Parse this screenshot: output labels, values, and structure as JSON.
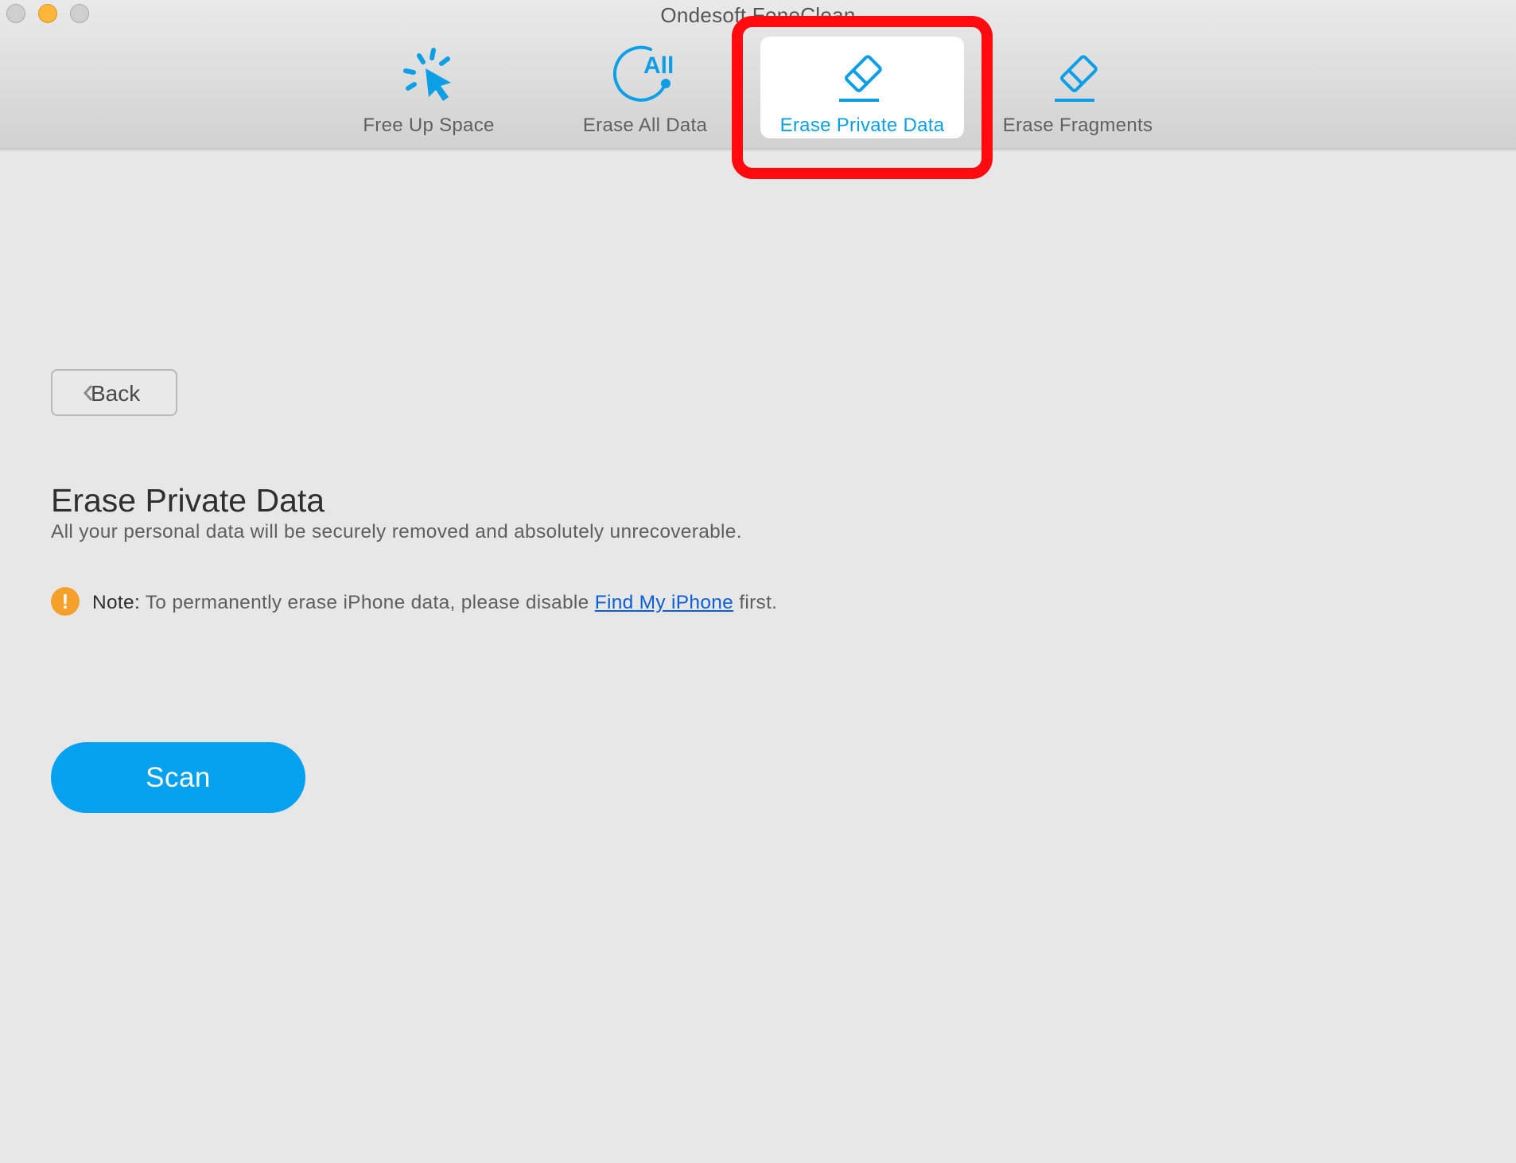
{
  "window": {
    "title": "Ondesoft FoneClean",
    "controls": [
      "close",
      "minimize",
      "maximize"
    ]
  },
  "toolbar": {
    "tabs": [
      {
        "label": "Free Up Space",
        "icon": "cursor-click-icon",
        "selected": false
      },
      {
        "label": "Erase All Data",
        "icon": "erase-all-icon",
        "selected": false
      },
      {
        "label": "Erase Private Data",
        "icon": "eraser-icon",
        "selected": true
      },
      {
        "label": "Erase Fragments",
        "icon": "eraser-icon",
        "selected": false
      }
    ]
  },
  "main": {
    "back_label": "Back",
    "heading": "Erase Private Data",
    "subtitle": "All your personal data will be securely removed and absolutely unrecoverable.",
    "note": {
      "icon": "warning-icon",
      "icon_glyph": "!",
      "lead": "Note:",
      "text_before": "To permanently erase iPhone data, please disable",
      "link": "Find My iPhone",
      "text_after": "first."
    },
    "scan_label": "Scan"
  },
  "colors": {
    "accent": "#04a1ef",
    "selected_tab_text": "#0d9fe3",
    "link": "#0b5ed7",
    "warning": "#f5a02a",
    "annotation": "#ff0a0f"
  }
}
